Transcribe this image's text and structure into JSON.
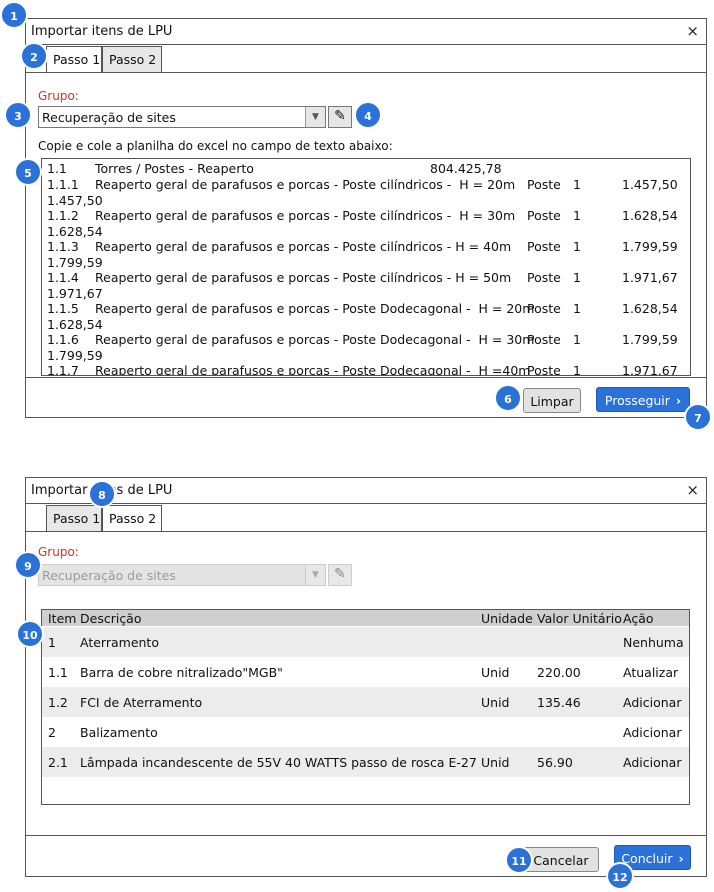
{
  "dialog1": {
    "title": "Importar itens de LPU",
    "close": "×",
    "tabs": [
      "Passo 1",
      "Passo 2"
    ],
    "group_label": "Grupo:",
    "group_value": "Recuperação de sites",
    "instructions": "Copie e cole a planilha do excel no campo de texto abaixo:",
    "text_lines": [
      {
        "code": "1.1",
        "desc": "Torres / Postes - Reaperto",
        "unit": "",
        "qty": "",
        "price": "804.425,78"
      },
      {
        "code": "1.1.1",
        "desc": "Reaperto geral de parafusos e porcas - Poste cilíndricos -  H = 20m",
        "unit": "Poste",
        "qty": "1",
        "price": "1.457,50",
        "wrap": "1.457,50"
      },
      {
        "code": "1.1.2",
        "desc": "Reaperto geral de parafusos e porcas - Poste cilíndricos -  H = 30m",
        "unit": "Poste",
        "qty": "1",
        "price": "1.628,54",
        "wrap": "1.628,54"
      },
      {
        "code": "1.1.3",
        "desc": "Reaperto geral de parafusos e porcas - Poste cilíndricos - H = 40m",
        "unit": "Poste",
        "qty": "1",
        "price": "1.799,59",
        "wrap": "1.799,59"
      },
      {
        "code": "1.1.4",
        "desc": "Reaperto geral de parafusos e porcas - Poste cilíndricos - H = 50m",
        "unit": "Poste",
        "qty": "1",
        "price": "1.971,67",
        "wrap": "1.971,67"
      },
      {
        "code": "1.1.5",
        "desc": "Reaperto geral de parafusos e porcas - Poste Dodecagonal -  H = 20m",
        "unit": "Poste",
        "qty": "1",
        "price": "1.628,54",
        "wrap": "1.628,54"
      },
      {
        "code": "1.1.6",
        "desc": "Reaperto geral de parafusos e porcas - Poste Dodecagonal -  H = 30m",
        "unit": "Poste",
        "qty": "1",
        "price": "1.799,59",
        "wrap": "1.799,59"
      },
      {
        "code": "1.1.7",
        "desc": "Reaperto geral de parafusos e porcas - Poste Dodecagonal -  H =40m",
        "unit": "Poste",
        "qty": "1",
        "price": "1.971,67"
      }
    ],
    "btn_clear": "Limpar",
    "btn_next": "Prosseguir"
  },
  "dialog2": {
    "title": "Importar itens de LPU",
    "close": "×",
    "tabs": [
      "Passo 1",
      "Passo 2"
    ],
    "group_label": "Grupo:",
    "group_value": "Recuperação de sites",
    "columns": [
      "Item",
      "Descrição",
      "Unidade",
      "Valor Unitário",
      "Ação"
    ],
    "rows": [
      {
        "item": "1",
        "desc": "Aterramento",
        "unit": "",
        "value": "",
        "action": "Nenhuma"
      },
      {
        "item": "1.1",
        "desc": "Barra de cobre nitralizado\"MGB\"",
        "unit": "Unid",
        "value": "220.00",
        "action": "Atualizar"
      },
      {
        "item": "1.2",
        "desc": "FCI de Aterramento",
        "unit": "Unid",
        "value": "135.46",
        "action": "Adicionar"
      },
      {
        "item": "2",
        "desc": "Balizamento",
        "unit": "",
        "value": "",
        "action": "Adicionar"
      },
      {
        "item": "2.1",
        "desc": "Lâmpada incandescente de 55V 40 WATTS passo de rosca E-27",
        "unit": "Unid",
        "value": "56.90",
        "action": "Adicionar"
      }
    ],
    "btn_cancel": "Cancelar",
    "btn_finish": "Concluir"
  },
  "badges": [
    "1",
    "2",
    "3",
    "4",
    "5",
    "6",
    "7",
    "8",
    "9",
    "10",
    "11",
    "12"
  ],
  "icons": {
    "pencil": "pencil-icon",
    "dropdown": "chevron-down-icon",
    "next": "chevron-right-icon",
    "close": "close-icon"
  },
  "colors": {
    "accent": "#2b72d8",
    "label_red": "#c0392b",
    "header_gray": "#cfcfcf"
  }
}
